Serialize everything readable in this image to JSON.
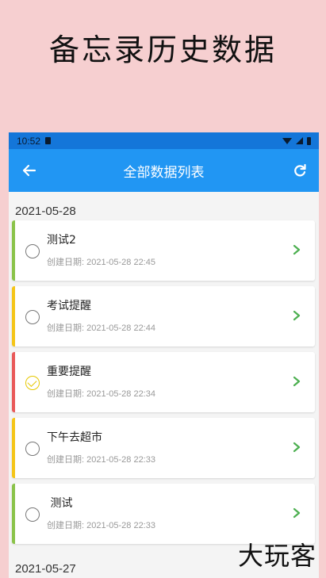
{
  "promo_title": "备忘录历史数据",
  "status_bar": {
    "time": "10:52"
  },
  "app_bar": {
    "title": "全部数据列表",
    "back_icon": "arrow-left-icon",
    "refresh_icon": "refresh-icon"
  },
  "groups": [
    {
      "date": "2021-05-28",
      "items": [
        {
          "title": "测试2",
          "created_label": "创建日期:",
          "created": "2021-05-28 22:45",
          "done": false,
          "accent": "#8bc34a"
        },
        {
          "title": "考试提醒",
          "created_label": "创建日期:",
          "created": "2021-05-28 22:44",
          "done": false,
          "accent": "#f5c518"
        },
        {
          "title": "重要提醒",
          "created_label": "创建日期:",
          "created": "2021-05-28 22:34",
          "done": true,
          "accent": "#e95a5a"
        },
        {
          "title": "下午去超市",
          "created_label": "创建日期:",
          "created": "2021-05-28 22:33",
          "done": false,
          "accent": "#f5c518"
        },
        {
          "title": " 测试",
          "created_label": "创建日期:",
          "created": "2021-05-28 22:33",
          "done": false,
          "accent": "#8bc34a"
        }
      ]
    },
    {
      "date": "2021-05-27",
      "items": []
    }
  ],
  "watermark": "大玩客",
  "colors": {
    "app_bar": "#2196f3",
    "status_bar": "#1476d9",
    "chevron": "#4caf50",
    "done_check": "#e6c800"
  }
}
